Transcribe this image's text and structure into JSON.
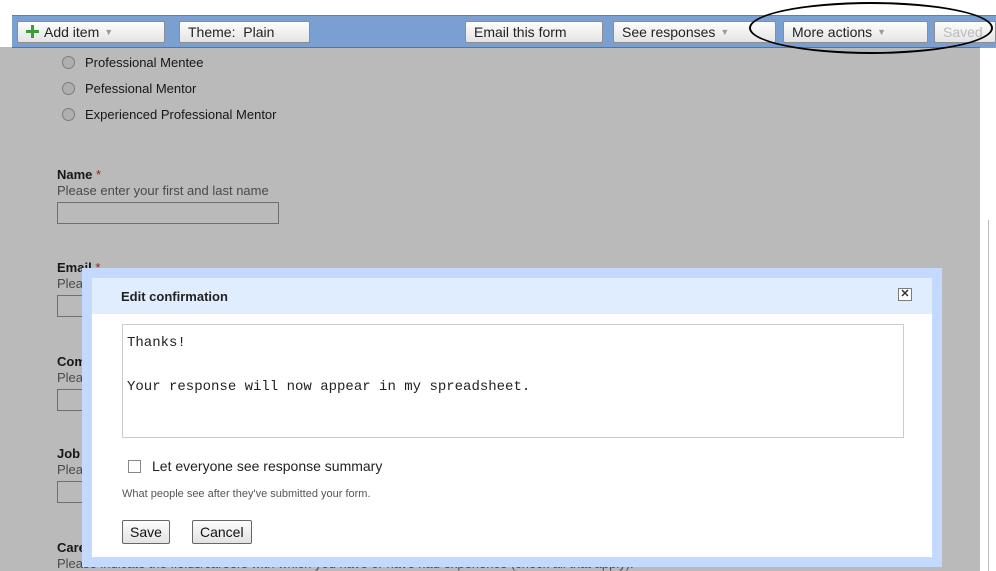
{
  "toolbar": {
    "add_item": "Add item",
    "theme": "Theme:  Plain",
    "email_form": "Email this form",
    "see_responses": "See responses",
    "more_actions": "More actions",
    "saved": "Saved"
  },
  "form": {
    "radio_options": [
      "Professional Mentee",
      "Pefessional Mentor",
      "Experienced Professional Mentor"
    ],
    "questions": {
      "name": {
        "title": "Name",
        "required": "*",
        "help": "Please enter your first and last name"
      },
      "email": {
        "title": "Email",
        "required": "*",
        "help": "Plea"
      },
      "com": {
        "title": "Com",
        "help": "Plea"
      },
      "job": {
        "title": "Job",
        "help": "Plea"
      },
      "career": {
        "title": "Care",
        "help": "Please indicate the fields/careers with which you have or have had experience (check all that apply)."
      }
    }
  },
  "dialog": {
    "title": "Edit confirmation",
    "close": "✕",
    "message": "Thanks!\n\nYour response will now appear in my spreadsheet.",
    "checkbox_label": "Let everyone see response summary",
    "checkbox_checked": false,
    "help": "What people see after they've submitted your form.",
    "save": "Save",
    "cancel": "Cancel"
  },
  "colors": {
    "toolbar": "#7aa0d2",
    "dialog_border": "#c3d9ff",
    "dialog_title_bg": "#e0edfe",
    "required": "#d03030"
  },
  "icons": {
    "add": "green-plus-icon",
    "caret": "chevron-down-icon",
    "close": "close-icon"
  }
}
